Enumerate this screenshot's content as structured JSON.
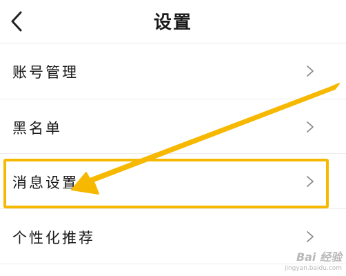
{
  "header": {
    "title": "设置",
    "back_icon": "chevron-left-icon"
  },
  "menu": {
    "items": [
      {
        "label": "账号管理",
        "icon": "chevron-right-icon"
      },
      {
        "label": "黑名单",
        "icon": "chevron-right-icon"
      },
      {
        "label": "消息设置",
        "icon": "chevron-right-icon",
        "highlighted": true
      },
      {
        "label": "个性化推荐",
        "icon": "chevron-right-icon"
      }
    ]
  },
  "annotation": {
    "highlight_color": "#F6B800",
    "arrow_color": "#F6B800",
    "arrow_target": "消息设置"
  },
  "watermark": {
    "main": "Bai 经验",
    "sub": "jingyan.baidu.com"
  }
}
